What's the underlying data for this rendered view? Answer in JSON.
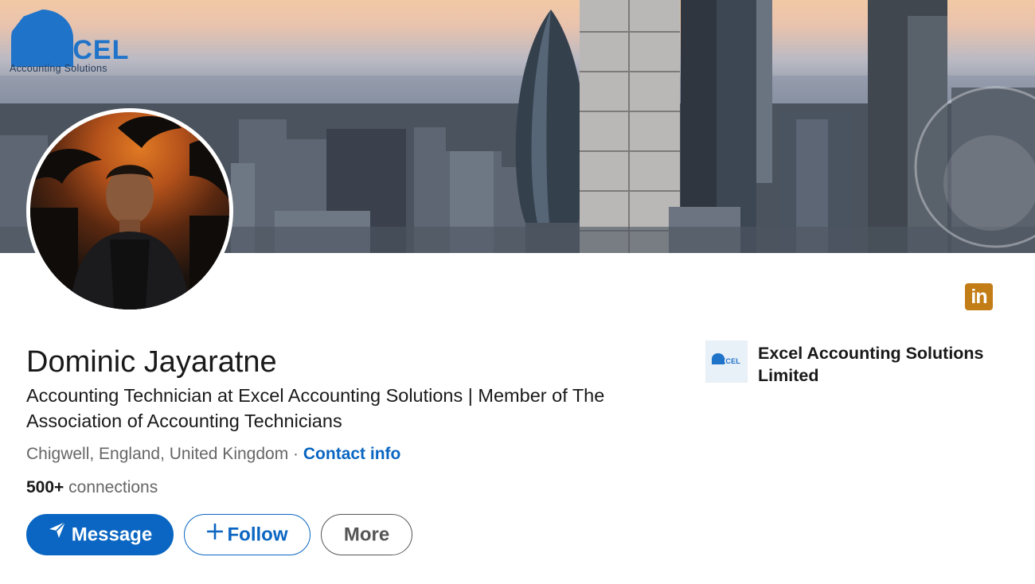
{
  "banner": {
    "logo_wordmark": "EXCEL",
    "logo_tagline": "Accounting Solutions"
  },
  "profile": {
    "name": "Dominic Jayaratne",
    "headline": "Accounting Technician at Excel Accounting Solutions | Member of The Association of Accounting Technicians",
    "location": "Chigwell, England, United Kingdom",
    "separator": " · ",
    "contact_label": "Contact info",
    "connections_count": "500+",
    "connections_label": " connections"
  },
  "actions": {
    "message_label": "Message",
    "follow_label": "Follow",
    "follow_icon": "+",
    "more_label": "More"
  },
  "company": {
    "name": "Excel Accounting Solutions Limited",
    "logo_text": "EXCEL"
  },
  "social": {
    "linkedin_glyph": "in"
  },
  "colors": {
    "primary_blue": "#0a66c2",
    "linkedin_badge": "#c37d16",
    "brand_blue": "#1f73c9"
  }
}
